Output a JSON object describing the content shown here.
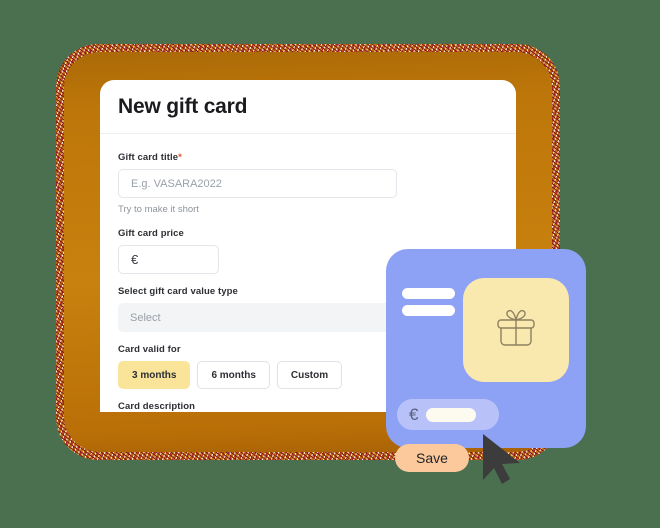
{
  "theme": {
    "background": "#4a7050",
    "frame_orange": "#c8810e",
    "panel_white": "#ffffff",
    "accent_yellow": "#f9e49a",
    "card_blue": "#8da2f5",
    "tile_yellow": "#fae9ae",
    "euro_pill_lilac": "#b9c2f8",
    "save_peach": "#fbc99b",
    "required_red": "#e8502a"
  },
  "panel": {
    "title": "New gift card"
  },
  "form": {
    "fields": [
      {
        "label": "Gift card title",
        "required_marker": "*",
        "placeholder": "E.g. VASARA2022",
        "helper": "Try to make it short"
      },
      {
        "label": "Gift card price",
        "value": "€"
      },
      {
        "label": "Select gift card value type",
        "placeholder": "Select"
      },
      {
        "label": "Card valid for"
      },
      {
        "label": "Card description",
        "value": ""
      }
    ],
    "valid_for_options": [
      {
        "label": "3 months",
        "selected": true
      },
      {
        "label": "6 months",
        "selected": false
      },
      {
        "label": "Custom",
        "selected": false
      }
    ]
  },
  "gift_card_preview": {
    "icon": "gift-box-icon",
    "currency_symbol": "€",
    "placeholder_lines": 2
  },
  "save_button": {
    "label": "Save"
  },
  "cursor": {
    "icon": "mouse-pointer-icon"
  }
}
